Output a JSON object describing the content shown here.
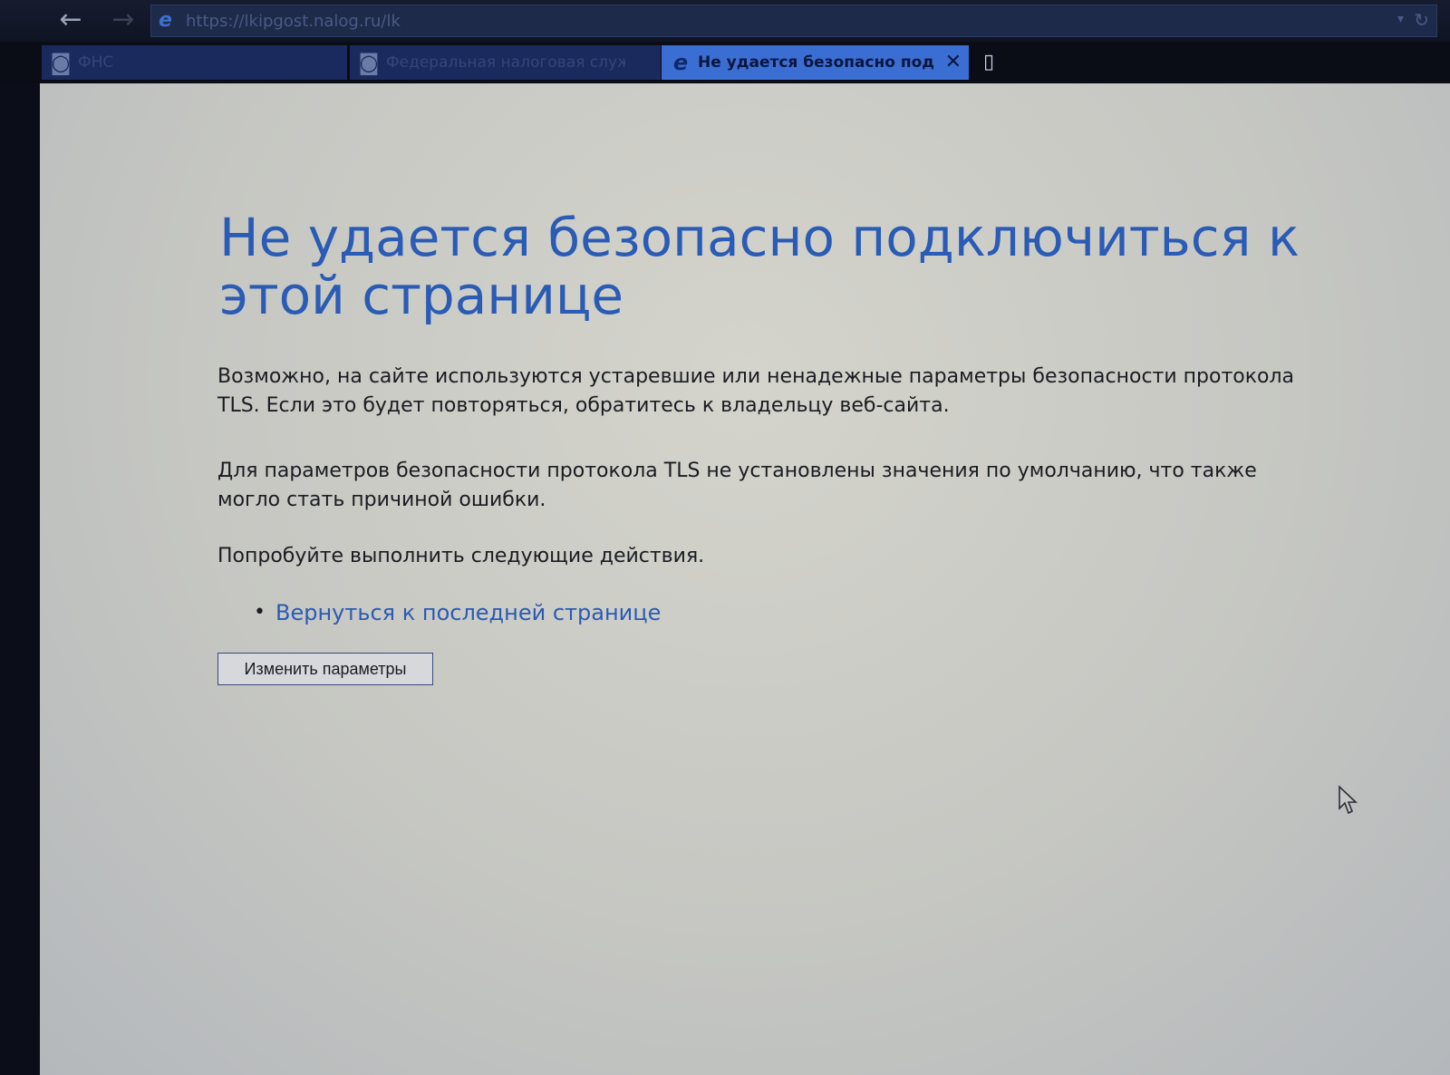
{
  "browser": {
    "address": {
      "url": "https://lkipgost.nalog.ru/lk",
      "page_icon": "ie-icon"
    },
    "nav": {
      "back_icon": "back-arrow-icon",
      "forward_icon": "forward-arrow-icon",
      "back_glyph": "←",
      "forward_glyph": "→",
      "dropdown_glyph": "▾",
      "refresh_glyph": "↻"
    },
    "tabs": [
      {
        "title": "ФНС",
        "icon": "fns-icon",
        "active": false
      },
      {
        "title": "Федеральная налоговая служ...",
        "icon": "fns-icon",
        "active": false
      },
      {
        "title": "Не удается безопасно под...",
        "icon": "ie-icon",
        "active": true,
        "close_glyph": "✕"
      }
    ],
    "new_tab_icon": "new-tab-icon"
  },
  "error_page": {
    "title": "Не удается безопасно подключиться к этой странице",
    "paragraph_1": "Возможно, на сайте используются устаревшие или ненадежные параметры безопасности протокола TLS. Если это будет повторяться, обратитесь к владельцу веб-сайта.",
    "paragraph_2": "Для параметров безопасности протокола TLS не установлены значения по умолчанию, что также могло стать причиной ошибки.",
    "paragraph_3": "Попробуйте выполнить следующие действия.",
    "actions": [
      {
        "label": "Вернуться к последней странице"
      }
    ],
    "button_label": "Изменить параметры"
  },
  "colors": {
    "title": "#2a5bb5",
    "link": "#2a5bb5",
    "active_tab": "#3b6ed2",
    "background": "#c6c7c2"
  }
}
